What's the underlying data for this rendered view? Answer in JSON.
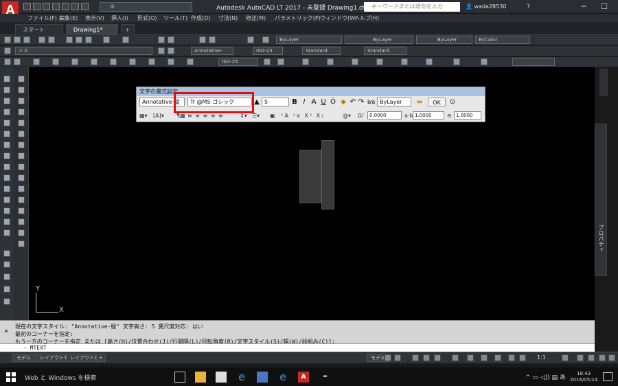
{
  "app": {
    "logo_letter": "A",
    "logo_sub": "LT",
    "window_title": "Autodesk AutoCAD LT 2017 - 未登録    Drawing1.dwg",
    "search_placeholder": "キーワードまたは語句を入力",
    "user_name": "wada28530",
    "accent": "#c62828"
  },
  "menu": [
    "ファイル(F)",
    "編集(E)",
    "表示(V)",
    "挿入(I)",
    "形式(O)",
    "ツール(T)",
    "作成(D)",
    "寸法(N)",
    "修正(M)",
    "パラメトリック(P)",
    "ウィンドウ(W)",
    "ヘルプ(H)"
  ],
  "tabs": {
    "start": "スタート",
    "drawing": "Drawing1*",
    "add": "+"
  },
  "toolbar1": {
    "layer_color": "ByLayer",
    "linetype": "ByLayer",
    "lineweight": "ByLayer",
    "plotstyle": "ByColor"
  },
  "toolbar2": {
    "layer": "0",
    "annotative": "Annotative-",
    "iso": "ISO-25",
    "style1": "Standard",
    "style2": "Standard"
  },
  "toolbar3": {
    "iso": "ISO-25"
  },
  "format_dialog": {
    "title": "文字の書式設定",
    "style": "Annotative-縦",
    "font": "Tr @MS ゴシック",
    "height": "5",
    "bold": "B",
    "italic": "I",
    "strike": "A",
    "underline": "U",
    "overline": "Ō",
    "color": "ByLayer",
    "ok": "OK",
    "oblique": "0.0000",
    "tracking": "1.0000",
    "width": "1.0000"
  },
  "ucs": {
    "y": "Y",
    "x": "X"
  },
  "cmdline": {
    "line1": "現在の文字スタイル:  \"Annotative-縦\"  文字高さ:  5  異尺度対応:  はい",
    "line2": "最初のコーナーを指定:",
    "line3": "もう一方のコーナーを指定 または [高さ(H)/位置合わせ(J)/行間隔(L)/回転角度(R)/文字スタイル(S)/幅(W)/段組み(C)]:",
    "input": "- MTEXT"
  },
  "status": {
    "model": "モデル",
    "layout1": "レイアウト1",
    "layout2": "レイアウト2",
    "model_btn": "モデル",
    "scale": "1:1"
  },
  "right_panel": {
    "label": "プロパティ"
  },
  "taskbar": {
    "search": "Web と Windows を検索",
    "ime": "あ",
    "time": "18:43",
    "date": "2016/05/14"
  }
}
